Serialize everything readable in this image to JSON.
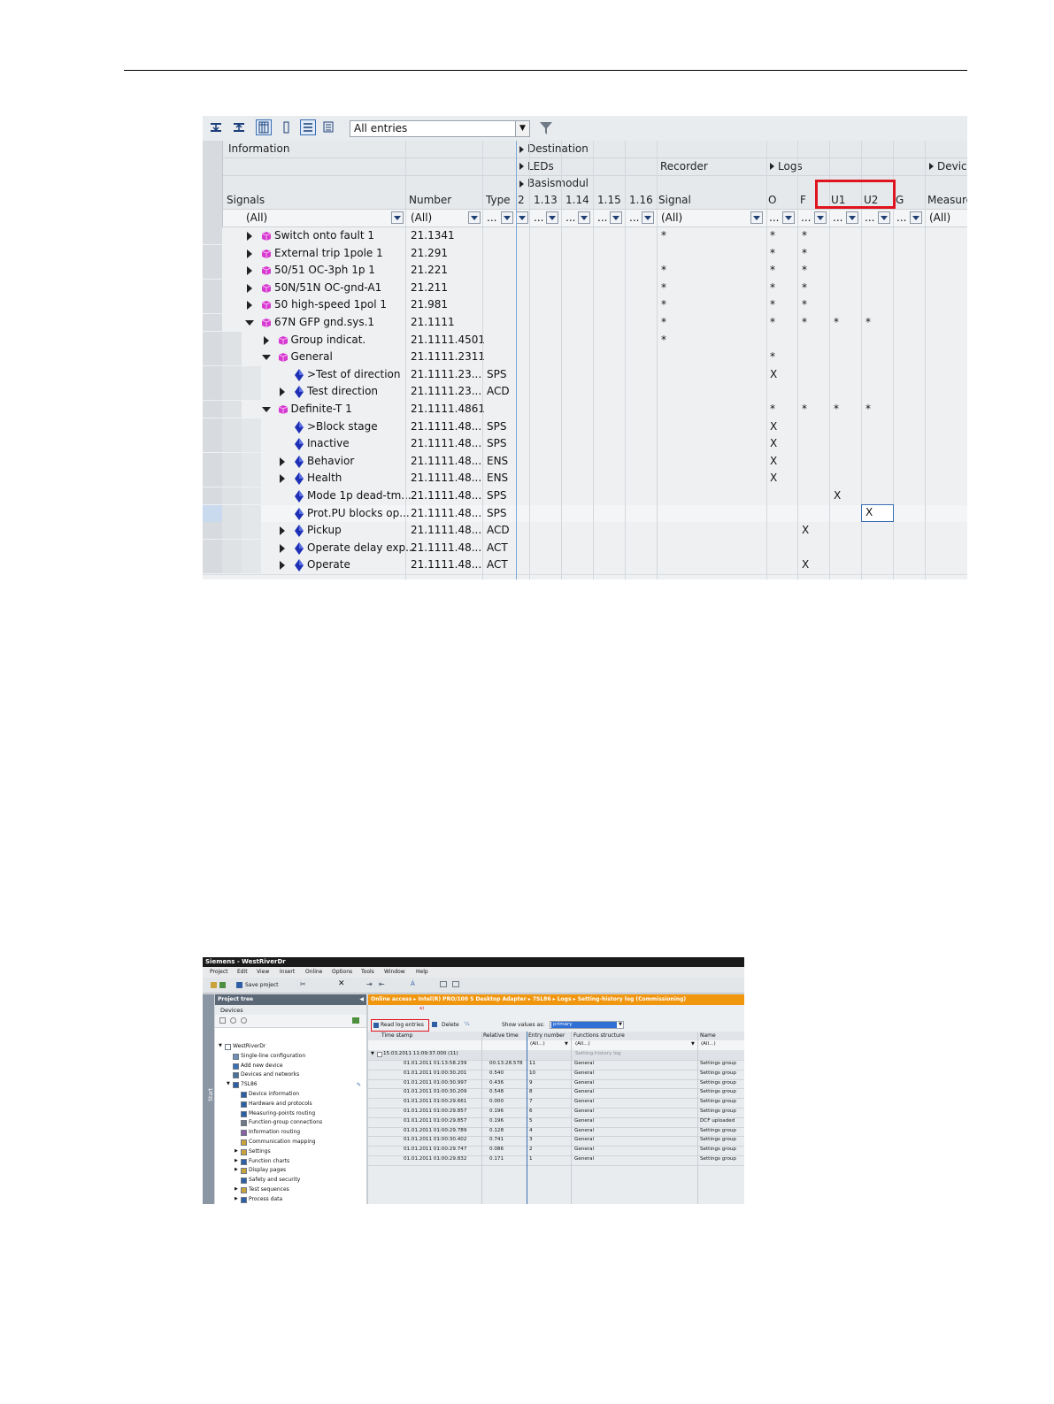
{
  "screenshot1": {
    "toolbar": {
      "filter_value": "All entries"
    },
    "headers": {
      "information": "Information",
      "destination": "Destination",
      "leds": "LEDs",
      "recorder": "Recorder",
      "logs": "Logs",
      "device": "Device",
      "basismodul": "Basismodul",
      "signals": "Signals",
      "number": "Number",
      "type": "Type",
      "col_2": "2",
      "col_113": "1.13",
      "col_114": "1.14",
      "col_115": "1.15",
      "col_116": "1.16",
      "signal": "Signal",
      "o": "O",
      "f": "F",
      "u1": "U1",
      "u2": "U2",
      "g": "G",
      "measure": "Measure"
    },
    "filters": {
      "signals": "(All)",
      "number": "(All)",
      "dots": "...",
      "signal": "(All)",
      "measure": "(All)"
    },
    "rows": [
      {
        "name": "Switch onto fault 1",
        "number": "21.1341",
        "type": "",
        "signal": "*",
        "o": "*",
        "f": "*",
        "u1": "",
        "u2": ""
      },
      {
        "name": "External trip 1pole 1",
        "number": "21.291",
        "type": "",
        "signal": "",
        "o": "*",
        "f": "*",
        "u1": "",
        "u2": ""
      },
      {
        "name": "50/51 OC-3ph 1p 1",
        "number": "21.221",
        "type": "",
        "signal": "*",
        "o": "*",
        "f": "*",
        "u1": "",
        "u2": ""
      },
      {
        "name": "50N/51N OC-gnd-A1",
        "number": "21.211",
        "type": "",
        "signal": "*",
        "o": "*",
        "f": "*",
        "u1": "",
        "u2": ""
      },
      {
        "name": "50 high-speed 1pol 1",
        "number": "21.981",
        "type": "",
        "signal": "*",
        "o": "*",
        "f": "*",
        "u1": "",
        "u2": ""
      },
      {
        "name": "67N GFP gnd.sys.1",
        "number": "21.1111",
        "type": "",
        "signal": "*",
        "o": "*",
        "f": "*",
        "u1": "*",
        "u2": "*"
      },
      {
        "name": "Group indicat.",
        "number": "21.1111.4501",
        "type": "",
        "signal": "*",
        "o": "",
        "f": "",
        "u1": "",
        "u2": ""
      },
      {
        "name": "General",
        "number": "21.1111.2311",
        "type": "",
        "signal": "",
        "o": "*",
        "f": "",
        "u1": "",
        "u2": ""
      },
      {
        "name": ">Test of direction",
        "number": "21.1111.23...",
        "type": "SPS",
        "signal": "",
        "o": "X",
        "f": "",
        "u1": "",
        "u2": ""
      },
      {
        "name": "Test direction",
        "number": "21.1111.23...",
        "type": "ACD",
        "signal": "",
        "o": "",
        "f": "",
        "u1": "",
        "u2": ""
      },
      {
        "name": "Definite-T 1",
        "number": "21.1111.4861",
        "type": "",
        "signal": "",
        "o": "*",
        "f": "*",
        "u1": "*",
        "u2": "*"
      },
      {
        "name": ">Block stage",
        "number": "21.1111.48...",
        "type": "SPS",
        "signal": "",
        "o": "X",
        "f": "",
        "u1": "",
        "u2": ""
      },
      {
        "name": "Inactive",
        "number": "21.1111.48...",
        "type": "SPS",
        "signal": "",
        "o": "X",
        "f": "",
        "u1": "",
        "u2": ""
      },
      {
        "name": "Behavior",
        "number": "21.1111.48...",
        "type": "ENS",
        "signal": "",
        "o": "X",
        "f": "",
        "u1": "",
        "u2": ""
      },
      {
        "name": "Health",
        "number": "21.1111.48...",
        "type": "ENS",
        "signal": "",
        "o": "X",
        "f": "",
        "u1": "",
        "u2": ""
      },
      {
        "name": "Mode 1p dead-tm...",
        "number": "21.1111.48...",
        "type": "SPS",
        "signal": "",
        "o": "",
        "f": "",
        "u1": "X",
        "u2": ""
      },
      {
        "name": "Prot.PU blocks op...",
        "number": "21.1111.48...",
        "type": "SPS",
        "signal": "",
        "o": "",
        "f": "",
        "u1": "",
        "u2": "X"
      },
      {
        "name": "Pickup",
        "number": "21.1111.48...",
        "type": "ACD",
        "signal": "",
        "o": "",
        "f": "X",
        "u1": "",
        "u2": ""
      },
      {
        "name": "Operate delay exp...",
        "number": "21.1111.48...",
        "type": "ACT",
        "signal": "",
        "o": "",
        "f": "",
        "u1": "",
        "u2": ""
      },
      {
        "name": "Operate",
        "number": "21.1111.48...",
        "type": "ACT",
        "signal": "",
        "o": "",
        "f": "X",
        "u1": "",
        "u2": ""
      }
    ]
  },
  "screenshot2": {
    "title": "Siemens - WestRiverDr",
    "menu": [
      "Project",
      "Edit",
      "View",
      "Insert",
      "Online",
      "Options",
      "Tools",
      "Window",
      "Help"
    ],
    "save_label": "Save project",
    "project_tree_title": "Project tree",
    "start_label": "Start",
    "devices_tab": "Devices",
    "breadcrumb": "Online access  ▸  Intel(R) PRO/100 S Desktop Adapter  ▸  7SL86  ▸  Logs  ▸  Setting-history log (Commissioning)",
    "read_log_button": "Read log entries",
    "delete_button": "Delete",
    "show_values_label": "Show values as:",
    "show_values_value": "primary",
    "tree": [
      "WestRiverDr",
      "Single-line configuration",
      "Add new device",
      "Devices and networks",
      "7SL86",
      "Device information",
      "Hardware and protocols",
      "Measuring-points routing",
      "Function-group connections",
      "Information routing",
      "Communication mapping",
      "Settings",
      "Function charts",
      "Display pages",
      "Safety and security",
      "Test sequences",
      "Process data"
    ],
    "columns": [
      "Time stamp",
      "Relative time",
      "Entry number",
      "Functions structure",
      "Name"
    ],
    "filters": [
      "(All...)",
      "(All...)",
      "(All...)"
    ],
    "group_row": {
      "timestamp": "15.03.2011 11:09:37.000 (11)",
      "label": "Setting-history log"
    },
    "log_rows": [
      {
        "ts": "01.01.2011 01:13:58.239",
        "rel": "00:13:28.578",
        "entry": "11",
        "func": "General",
        "name": "Settings group"
      },
      {
        "ts": "01.01.2011 01:00:30.201",
        "rel": "0.540",
        "entry": "10",
        "func": "General",
        "name": "Settings group"
      },
      {
        "ts": "01.01.2011 01:00:30.997",
        "rel": "0.436",
        "entry": "9",
        "func": "General",
        "name": "Settings group"
      },
      {
        "ts": "01.01.2011 01:00:30.209",
        "rel": "0.548",
        "entry": "8",
        "func": "General",
        "name": "Settings group"
      },
      {
        "ts": "01.01.2011 01:00:29.661",
        "rel": "0.000",
        "entry": "7",
        "func": "General",
        "name": "Settings group"
      },
      {
        "ts": "01.01.2011 01:00:29.857",
        "rel": "0.196",
        "entry": "6",
        "func": "General",
        "name": "Settings group"
      },
      {
        "ts": "01.01.2011 01:00:29.857",
        "rel": "0.196",
        "entry": "5",
        "func": "General",
        "name": "DCF uploaded"
      },
      {
        "ts": "01.01.2011 01:00:29.789",
        "rel": "0.128",
        "entry": "4",
        "func": "General",
        "name": "Settings group"
      },
      {
        "ts": "01.01.2011 01:00:30.402",
        "rel": "0.741",
        "entry": "3",
        "func": "General",
        "name": "Settings group"
      },
      {
        "ts": "01.01.2011 01:00:29.747",
        "rel": "0.086",
        "entry": "2",
        "func": "General",
        "name": "Settings group"
      },
      {
        "ts": "01.01.2011 01:00:29.832",
        "rel": "0.171",
        "entry": "1",
        "func": "General",
        "name": "Settings group"
      }
    ]
  }
}
